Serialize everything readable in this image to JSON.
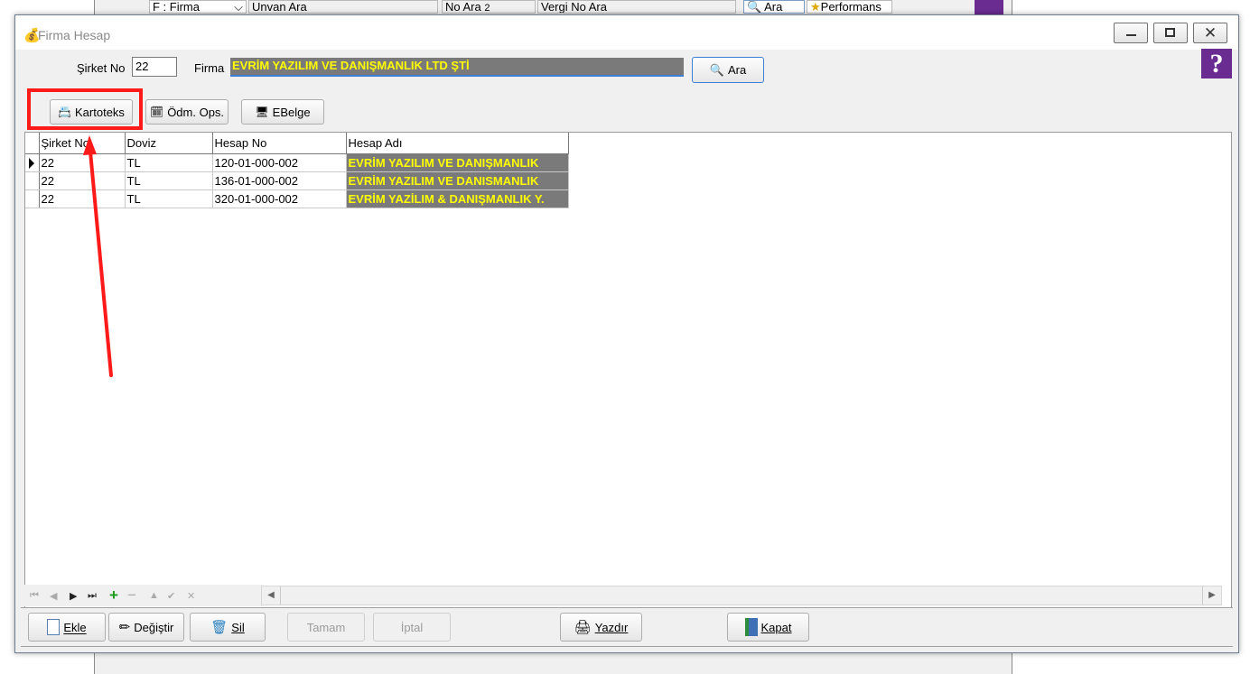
{
  "background_window": {
    "field1": "F : Firma",
    "field2": "Unvan Ara",
    "field3": "No Ara",
    "field3_value": "2",
    "field4": "Vergi No Ara",
    "search_label": "Ara",
    "performance_label": "Performans"
  },
  "window": {
    "title": "Firma Hesap"
  },
  "form": {
    "sirket_no_label": "Şirket No",
    "sirket_no_value": "22",
    "firma_label": "Firma",
    "firma_value": "EVRİM YAZILIM VE DANIŞMANLIK LTD ŞTİ",
    "search_button": "Ara"
  },
  "toolbar": {
    "kartoteks": "Kartoteks",
    "odm_ops": "Ödm. Ops.",
    "ebelge": "EBelge"
  },
  "grid": {
    "columns": [
      "Şirket No",
      "Doviz",
      "Hesap No",
      "Hesap Adı"
    ],
    "rows": [
      {
        "sirket_no": "22",
        "doviz": "TL",
        "hesap_no": "120-01-000-002",
        "hesap_adi": "EVRİM YAZILIM VE DANIŞMANLIK"
      },
      {
        "sirket_no": "22",
        "doviz": "TL",
        "hesap_no": "136-01-000-002",
        "hesap_adi": "EVRİM YAZILIM VE DANISMANLIK"
      },
      {
        "sirket_no": "22",
        "doviz": "TL",
        "hesap_no": "320-01-000-002",
        "hesap_adi": "EVRİM YAZİLIM & DANIŞMANLIK Y."
      }
    ]
  },
  "footer": {
    "ekle": "Ekle",
    "degistir": "Değiştir",
    "sil": "Sil",
    "tamam": "Tamam",
    "iptal": "İptal",
    "yazdir": "Yazdır",
    "kapat": "Kapat"
  },
  "colors": {
    "highlight_box": "#ff1a1a",
    "arrow": "#ff1a1a",
    "firma_bg": "#7a7a7a",
    "firma_text": "#ffff00"
  }
}
